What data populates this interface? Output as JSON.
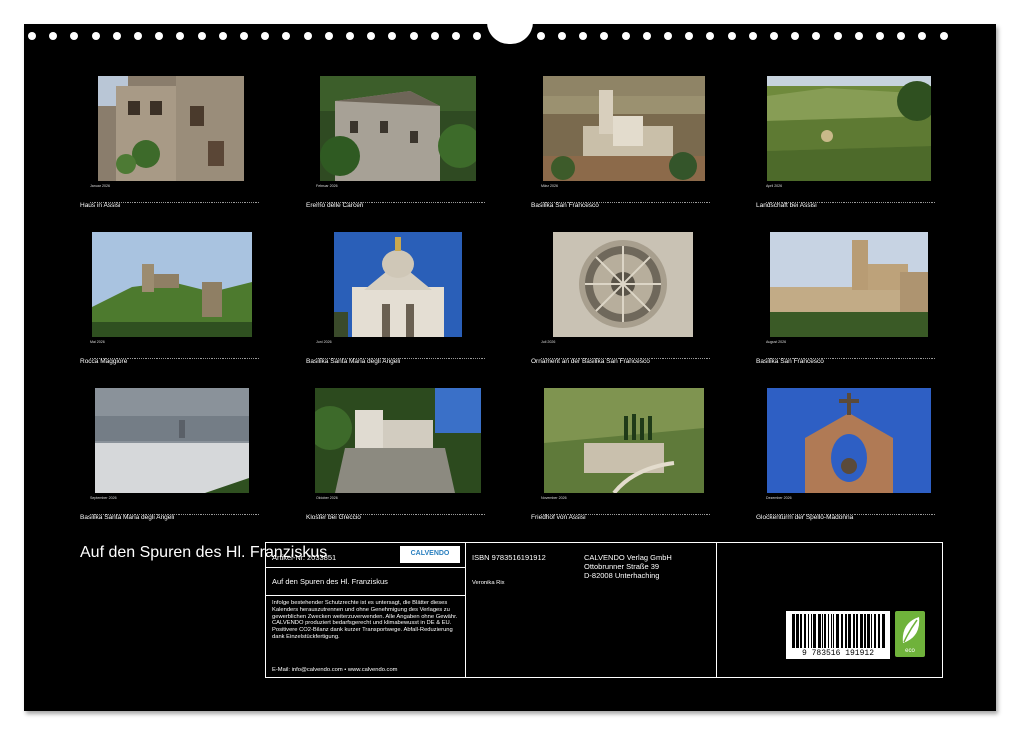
{
  "title": "Auf den Spuren des Hl. Franziskus",
  "months": [
    {
      "month": "Januar 2026",
      "caption": "Haus in Assisi"
    },
    {
      "month": "Februar 2026",
      "caption": "Eremo delle Carceri"
    },
    {
      "month": "März 2026",
      "caption": "Basilika San Francesco"
    },
    {
      "month": "April 2026",
      "caption": "Landschaft bei Assisi"
    },
    {
      "month": "Mai 2026",
      "caption": "Rocca Maggiore"
    },
    {
      "month": "Juni 2026",
      "caption": "Basilika Santa Maria degli Angeli"
    },
    {
      "month": "Juli 2026",
      "caption": "Ornament an der Basilika San Francesco"
    },
    {
      "month": "August 2026",
      "caption": "Basilika San Francesco"
    },
    {
      "month": "September 2026",
      "caption": "Basilika Santa Maria degli Angeli"
    },
    {
      "month": "Oktober 2026",
      "caption": "Kloster bei Greccio"
    },
    {
      "month": "November 2026",
      "caption": "Friedhof von Assisi"
    },
    {
      "month": "Dezember 2026",
      "caption": "Glockenturm der Spello-Madonna"
    }
  ],
  "info": {
    "article": "Artikel-Nr. 2033851",
    "logo": "CALVENDO",
    "title_line": "Auf den Spuren des Hl. Franziskus",
    "legal": "Infolge bestehender Schutzrechte ist es untersagt, die Blätter dieses Kalenders herauszutrennen und ohne Genehmigung des Verlages zu gewerblichen Zwecken weiterzuverwenden. Alle Angaben ohne Gewähr. CALVENDO produziert bedarfsgerecht und klimabewusst in DE & EU. Positivere CO2-Bilanz dank kurzer Transportwege. Abfall-Reduzierung dank Einzelstückfertigung.",
    "email": "E-Mail: info@calvendo.com • www.calvendo.com",
    "isbn": "ISBN 9783516191912",
    "author": "Veronika Rix",
    "publisher_1": "CALVENDO Verlag GmbH",
    "publisher_2": "Ottobrunner Straße 39",
    "publisher_3": "D-82008 Unterhaching",
    "barcode_number": "9 783516 191912",
    "eco_label": "eco"
  }
}
